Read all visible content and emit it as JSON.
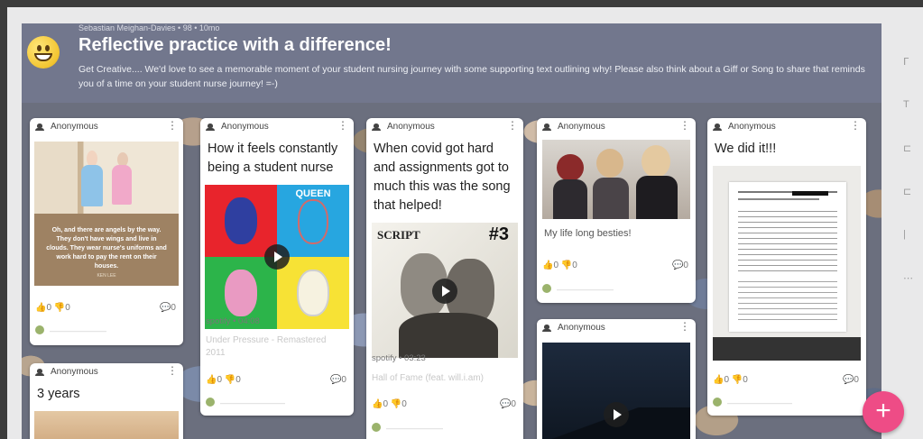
{
  "board": {
    "author_line": "Sebastian Meighan-Davies • 98 • 10mo",
    "title": "Reflective practice with a difference!",
    "description": "Get Creative.... We'd love to see a memorable moment of your student nursing journey with some supporting text outlining why! Please also think about a Giff or Song to share that reminds you of a time on your student nurse journey! =-)"
  },
  "cards": {
    "c1": {
      "author": "Anonymous",
      "quote": "Oh, and there are angels by the way. They don't have wings and live in clouds. They wear nurse's uniforms and work hard to pay the rent on their houses.",
      "quote_source": "KEN LEE",
      "reactions": "0 0",
      "comments": "0"
    },
    "c2": {
      "author": "Anonymous",
      "title": "How it feels constantly being a student nurse",
      "album_brand": "QUEEN",
      "meta": "spotify • 04:08",
      "track": "Under Pressure - Remastered 2011",
      "reactions": "0 0",
      "comments": "0"
    },
    "c3": {
      "author": "Anonymous",
      "title": "When covid got hard and assignments got to much this was the song that helped!",
      "album_brand": "SCRIPT",
      "album_number": "#3",
      "meta": "spotify • 03:23",
      "track": "Hall of Fame (feat. will.i.am)",
      "reactions": "0 0",
      "comments": "0"
    },
    "c4": {
      "author": "Anonymous",
      "text": "My life long besties!",
      "reactions": "0 0",
      "comments": "0"
    },
    "c5": {
      "author": "Anonymous"
    },
    "c6": {
      "author": "Anonymous",
      "title": "We did it!!!",
      "reactions": "0 0",
      "comments": "0"
    },
    "c7": {
      "author": "Anonymous",
      "title": "3 years"
    }
  },
  "fab_label": "+",
  "colors": {
    "header": "#72778d",
    "fab": "#ee4c86"
  }
}
